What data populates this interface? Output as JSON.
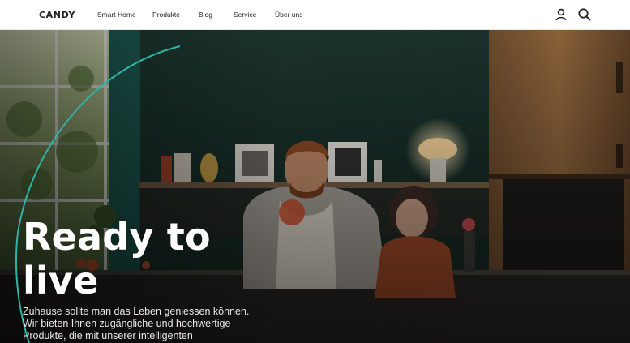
{
  "brand": {
    "logo_text": "CANDY"
  },
  "nav": {
    "items": [
      {
        "label": "Smart Home"
      },
      {
        "label": "Produkte"
      },
      {
        "label": "Blog"
      },
      {
        "label": "Service"
      },
      {
        "label": "Über uns"
      }
    ]
  },
  "header_icons": [
    "user-icon",
    "search-icon"
  ],
  "hero": {
    "title_line1": "Ready to",
    "title_line2": "live",
    "text_line1": "Zuhause sollte man das Leben geniessen können.",
    "text_line2": "Wir bieten Ihnen zugängliche und hochwertige",
    "text_line3": "Produkte, die mit unserer intelligenten"
  },
  "colors": {
    "header_bg": "#ffffff",
    "wall_green": "#1f3a33",
    "accent_arc": "#2fb3a6",
    "text_white": "#ffffff"
  }
}
